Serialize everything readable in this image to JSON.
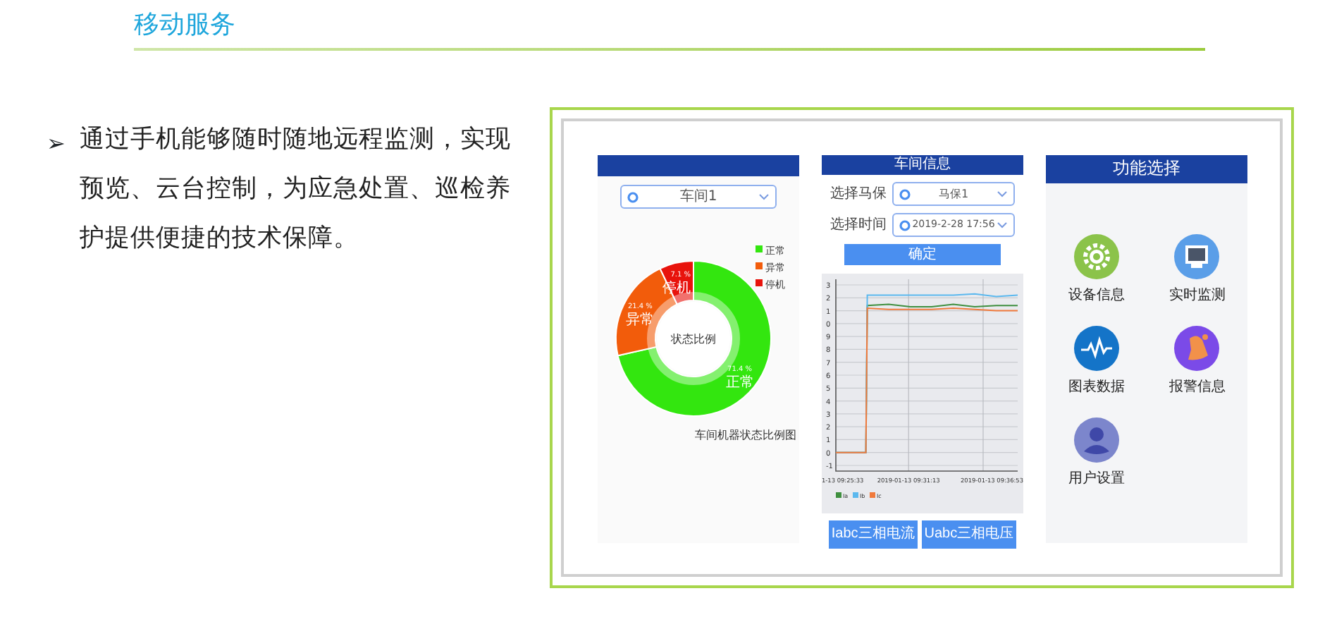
{
  "slide": {
    "title": "移动服务",
    "bullet": "➢",
    "text": "通过手机能够随时随地远程监测，实现预览、云台控制，为应急处置、巡检养护提供便捷的技术保障。"
  },
  "screens": [
    {
      "kind": "pie",
      "dropdown": {
        "value": "车间1"
      },
      "center_label": "状态比例",
      "caption": "车间机器状态比例图",
      "legend": [
        {
          "label": "正常",
          "color": "#33e60f"
        },
        {
          "label": "异常",
          "color": "#f25c0b"
        },
        {
          "label": "停机",
          "color": "#e8130c"
        }
      ],
      "chart_data": {
        "type": "donut",
        "categories": [
          "正常",
          "异常",
          "停机"
        ],
        "values": [
          71.4,
          21.4,
          7.1
        ],
        "value_labels": [
          "71.4 %",
          "21.4 %",
          "7.1 %"
        ]
      }
    },
    {
      "kind": "line",
      "header": "车间信息",
      "fields": [
        {
          "label": "选择马保",
          "value": "马保1"
        },
        {
          "label": "选择时间",
          "value": "2019-2-28 17:56"
        }
      ],
      "confirm_button": "确定",
      "line_chart": {
        "y_labels": [
          "3",
          "2",
          "1",
          "0",
          "9",
          "8",
          "7",
          "6",
          "5",
          "4",
          "3",
          "2",
          "1",
          "0",
          "-1"
        ],
        "x_labels": [
          "1-13 09:25:33",
          "2019-01-13 09:31:13",
          "2019-01-13 09:36:53"
        ],
        "legend": [
          {
            "label": "Ia",
            "color": "#3f8f3f"
          },
          {
            "label": "Ib",
            "color": "#5bb8ee"
          },
          {
            "label": "Ic",
            "color": "#f07a3c"
          }
        ]
      },
      "buttons": [
        "Iabc三相电流",
        "Uabc三相电压"
      ]
    },
    {
      "kind": "menu",
      "header": "功能选择",
      "items": [
        {
          "label": "设备信息"
        },
        {
          "label": "实时监测"
        },
        {
          "label": "图表数据"
        },
        {
          "label": "报警信息"
        },
        {
          "label": "用户设置"
        }
      ]
    }
  ]
}
